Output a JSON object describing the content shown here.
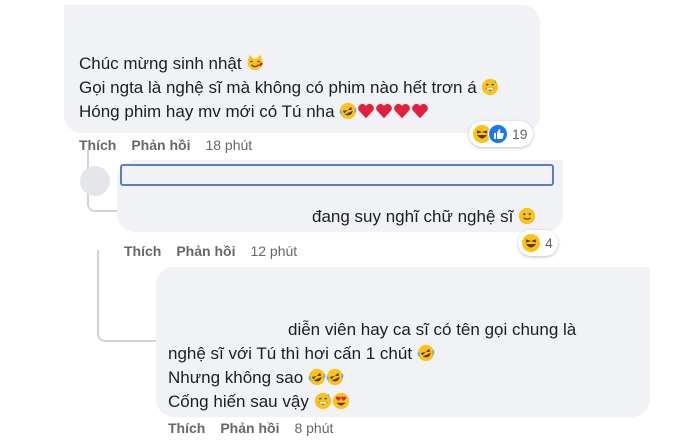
{
  "comments": [
    {
      "lines": [
        {
          "text": "Chúc mừng sinh nhật",
          "emojis": [
            "smiling-cat"
          ]
        },
        {
          "text": "Gọi ngta là nghệ sĩ mà không có phim nào hết trơn á",
          "emojis": [
            "grin-sweat"
          ]
        },
        {
          "text": "Hóng phim hay mv mới có Tú nha",
          "emojis": [
            "rofl",
            "heart",
            "heart",
            "heart",
            "heart"
          ]
        }
      ],
      "actions": {
        "like": "Thích",
        "reply": "Phản hồi",
        "time": "18 phút"
      },
      "reactions": {
        "icons": [
          "laughing",
          "like"
        ],
        "count": "19"
      }
    },
    {
      "lines": [
        {
          "text": "đang suy nghĩ chữ nghệ sĩ",
          "emojis": [
            "slight-smile"
          ]
        }
      ],
      "actions": {
        "like": "Thích",
        "reply": "Phản hồi",
        "time": "12 phút"
      },
      "reactions": {
        "icons": [
          "laughing"
        ],
        "count": "4"
      }
    },
    {
      "lines": [
        {
          "text": "diễn viên hay ca sĩ có tên gọi chung là",
          "emojis": []
        },
        {
          "text": "nghệ sĩ với Tú thì hơi cấn 1 chút",
          "emojis": [
            "rofl"
          ]
        },
        {
          "text": "Nhưng không sao",
          "emojis": [
            "rofl",
            "rofl"
          ]
        },
        {
          "text": "Cống hiến sau vậy",
          "emojis": [
            "grin-sweat",
            "heart-eyes"
          ]
        }
      ],
      "actions": {
        "like": "Thích",
        "reply": "Phản hồi",
        "time": "8 phút"
      }
    }
  ],
  "colors": {
    "bubble": "#f0f2f5",
    "actions": "#65676b",
    "like_blue": "#1877f2",
    "heart": "#e41e3f",
    "emoji": "#fcc21b"
  }
}
